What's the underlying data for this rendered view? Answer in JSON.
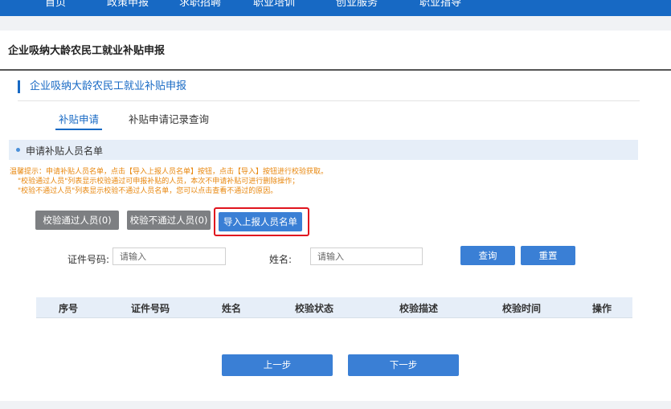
{
  "nav": {
    "items": [
      "首页",
      "政策申报",
      "求职招聘",
      "职业培训",
      "创业服务",
      "职业指导"
    ]
  },
  "page": {
    "title": "企业吸纳大龄农民工就业补贴申报",
    "section_title": "企业吸纳大龄农民工就业补贴申报"
  },
  "tabs": {
    "apply": "补贴申请",
    "records": "补贴申请记录查询"
  },
  "subsection": {
    "label": "申请补贴人员名单"
  },
  "notice": {
    "line1": "温馨提示：申请补贴人员名单，点击【导入上报人员名单】按钮，点击【导入】按钮进行校验获取。",
    "line2": "\"校验通过人员\"列表显示校验通过可申报补贴的人员，本次不申请补贴可进行删除操作；",
    "line3": "\"校验不通过人员\"列表显示校验不通过人员名单，您可以点击查看不通过的原因。"
  },
  "buttons": {
    "passed": "校验通过人员(0)",
    "failed": "校验不通过人员(0)",
    "import": "导入上报人员名单",
    "query": "查询",
    "reset": "重置",
    "prev": "上一步",
    "next": "下一步"
  },
  "search": {
    "id_label": "证件号码:",
    "id_placeholder": "请输入",
    "name_label": "姓名:",
    "name_placeholder": "请输入"
  },
  "table": {
    "headers": [
      "序号",
      "证件号码",
      "姓名",
      "校验状态",
      "校验描述",
      "校验时间",
      "操作"
    ]
  },
  "colors": {
    "primary": "#1769c4",
    "button_blue": "#3a7fd5",
    "button_gray": "#7d7f82",
    "notice_orange": "#e8870e",
    "highlight_red": "#e0141e"
  }
}
